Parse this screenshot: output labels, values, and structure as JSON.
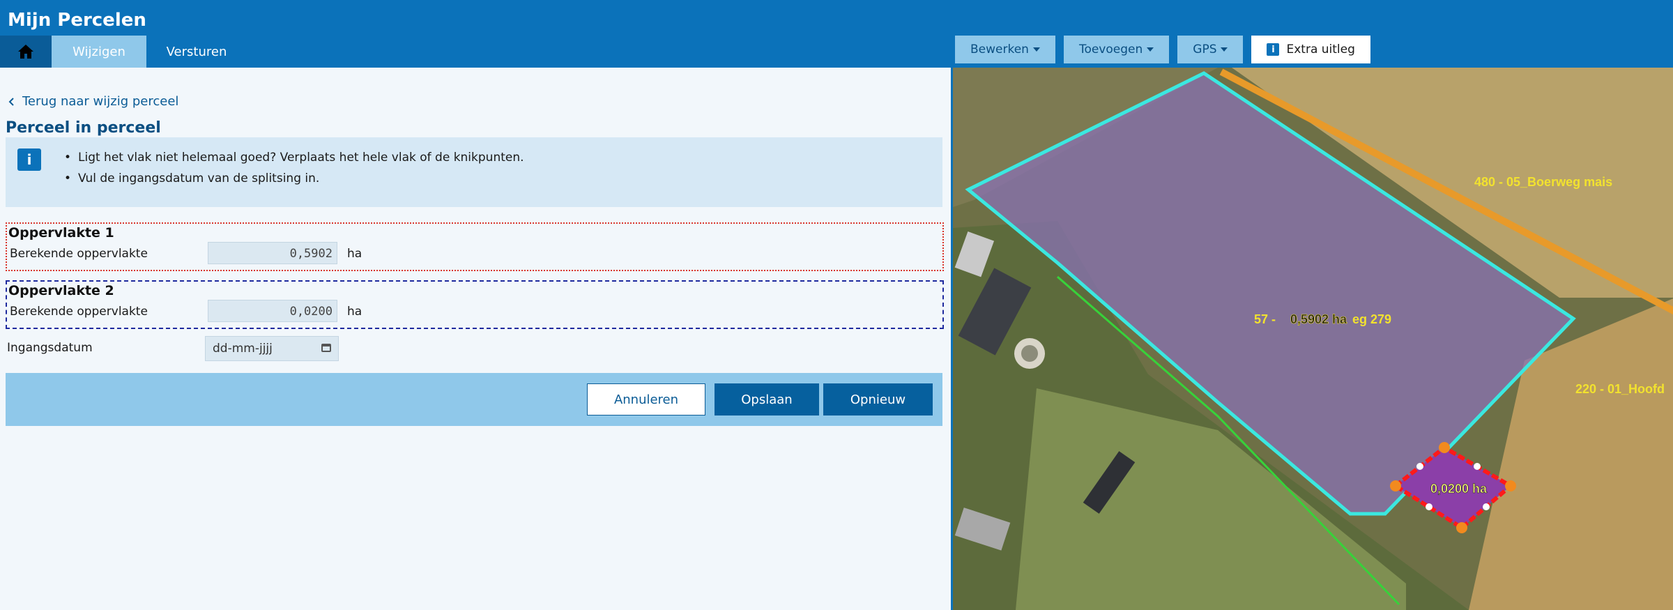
{
  "app": {
    "title": "Mijn Percelen"
  },
  "tabs": [
    {
      "label": "Wijzigen"
    },
    {
      "label": "Versturen"
    }
  ],
  "toolbar": {
    "edit": "Bewerken",
    "add": "Toevoegen",
    "gps": "GPS",
    "help": "Extra uitleg"
  },
  "panel": {
    "back_link": "Terug naar wijzig perceel",
    "title": "Perceel in perceel",
    "info": [
      "Ligt het vlak niet helemaal goed? Verplaats het hele vlak of de knikpunten.",
      "Vul de ingangsdatum van de splitsing in."
    ],
    "area1": {
      "title": "Oppervlakte 1",
      "label": "Berekende oppervlakte",
      "value": "0,5902",
      "unit": "ha"
    },
    "area2": {
      "title": "Oppervlakte 2",
      "label": "Berekende oppervlakte",
      "value": "0,0200",
      "unit": "ha"
    },
    "date": {
      "label": "Ingangsdatum",
      "placeholder": "dd-mm-jjjj"
    },
    "buttons": {
      "cancel": "Annuleren",
      "save": "Opslaan",
      "reset": "Opnieuw"
    }
  },
  "map": {
    "labels": {
      "field_top_right": "480  - 05_Boerweg mais",
      "field_main_id": "57  -",
      "field_main_suffix": "eg 279",
      "field_main_area": "0,5902 ha",
      "field_right": "220  - 01_Hoofd",
      "field_new_area": "0,0200 ha"
    },
    "colors": {
      "main_outline": "#3be8e0",
      "new_outline": "#ff1a1a",
      "vertex": "#f28a1e",
      "label": "#f2e22e"
    }
  }
}
